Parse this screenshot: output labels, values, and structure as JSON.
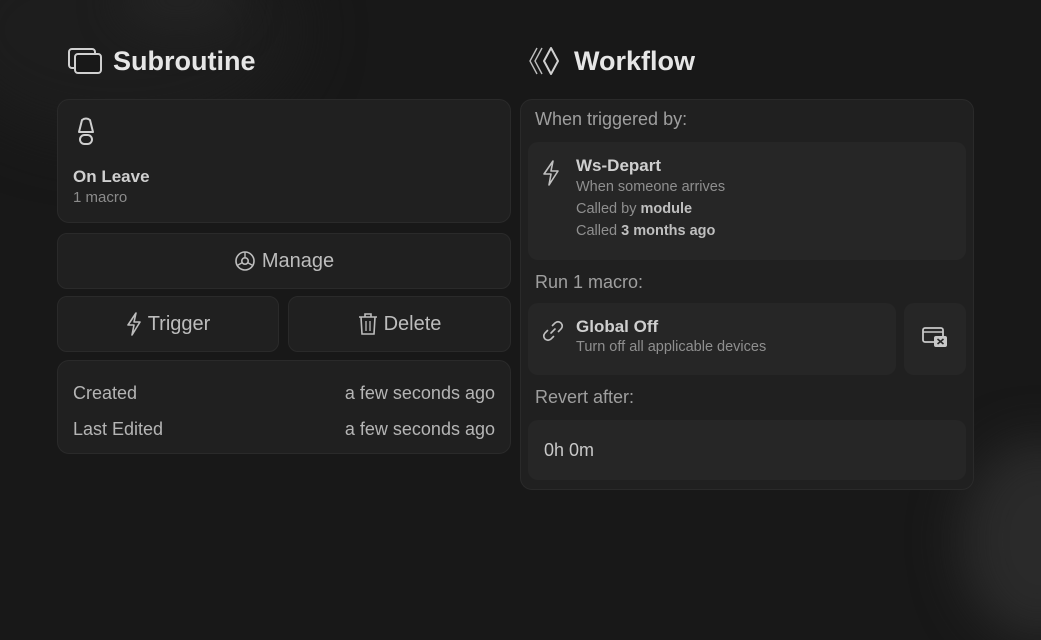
{
  "subroutine": {
    "title": "Subroutine",
    "icon": "stacked-windows-icon",
    "card": {
      "icon": "lamp-icon",
      "name": "On Leave",
      "macro_count": "1 macro"
    },
    "buttons": {
      "manage": "Manage",
      "manage_icon": "gear-icon",
      "trigger": "Trigger",
      "trigger_icon": "lightning-icon",
      "delete": "Delete",
      "delete_icon": "trash-icon"
    },
    "meta": {
      "created_label": "Created",
      "created_value": "a few seconds ago",
      "edited_label": "Last Edited",
      "edited_value": "a few seconds ago"
    }
  },
  "workflow": {
    "title": "Workflow",
    "icon": "workflow-diamond-icon",
    "triggered_by_label": "When triggered by:",
    "trigger": {
      "icon": "lightning-icon",
      "name": "Ws-Depart",
      "description": "When someone arrives",
      "called_by_prefix": "Called by",
      "called_by_value": "module",
      "called_prefix": "Called",
      "called_value": "3 months ago"
    },
    "run_label": "Run 1 macro:",
    "macro": {
      "icon": "link-icon",
      "name": "Global Off",
      "description": "Turn off all applicable devices",
      "remove_icon": "remove-window-icon"
    },
    "revert_label": "Revert after:",
    "revert_value": "0h 0m"
  },
  "colors": {
    "background": "#181818",
    "card": "#202020",
    "inner_card": "#262626",
    "text": "#d4d4d4"
  }
}
